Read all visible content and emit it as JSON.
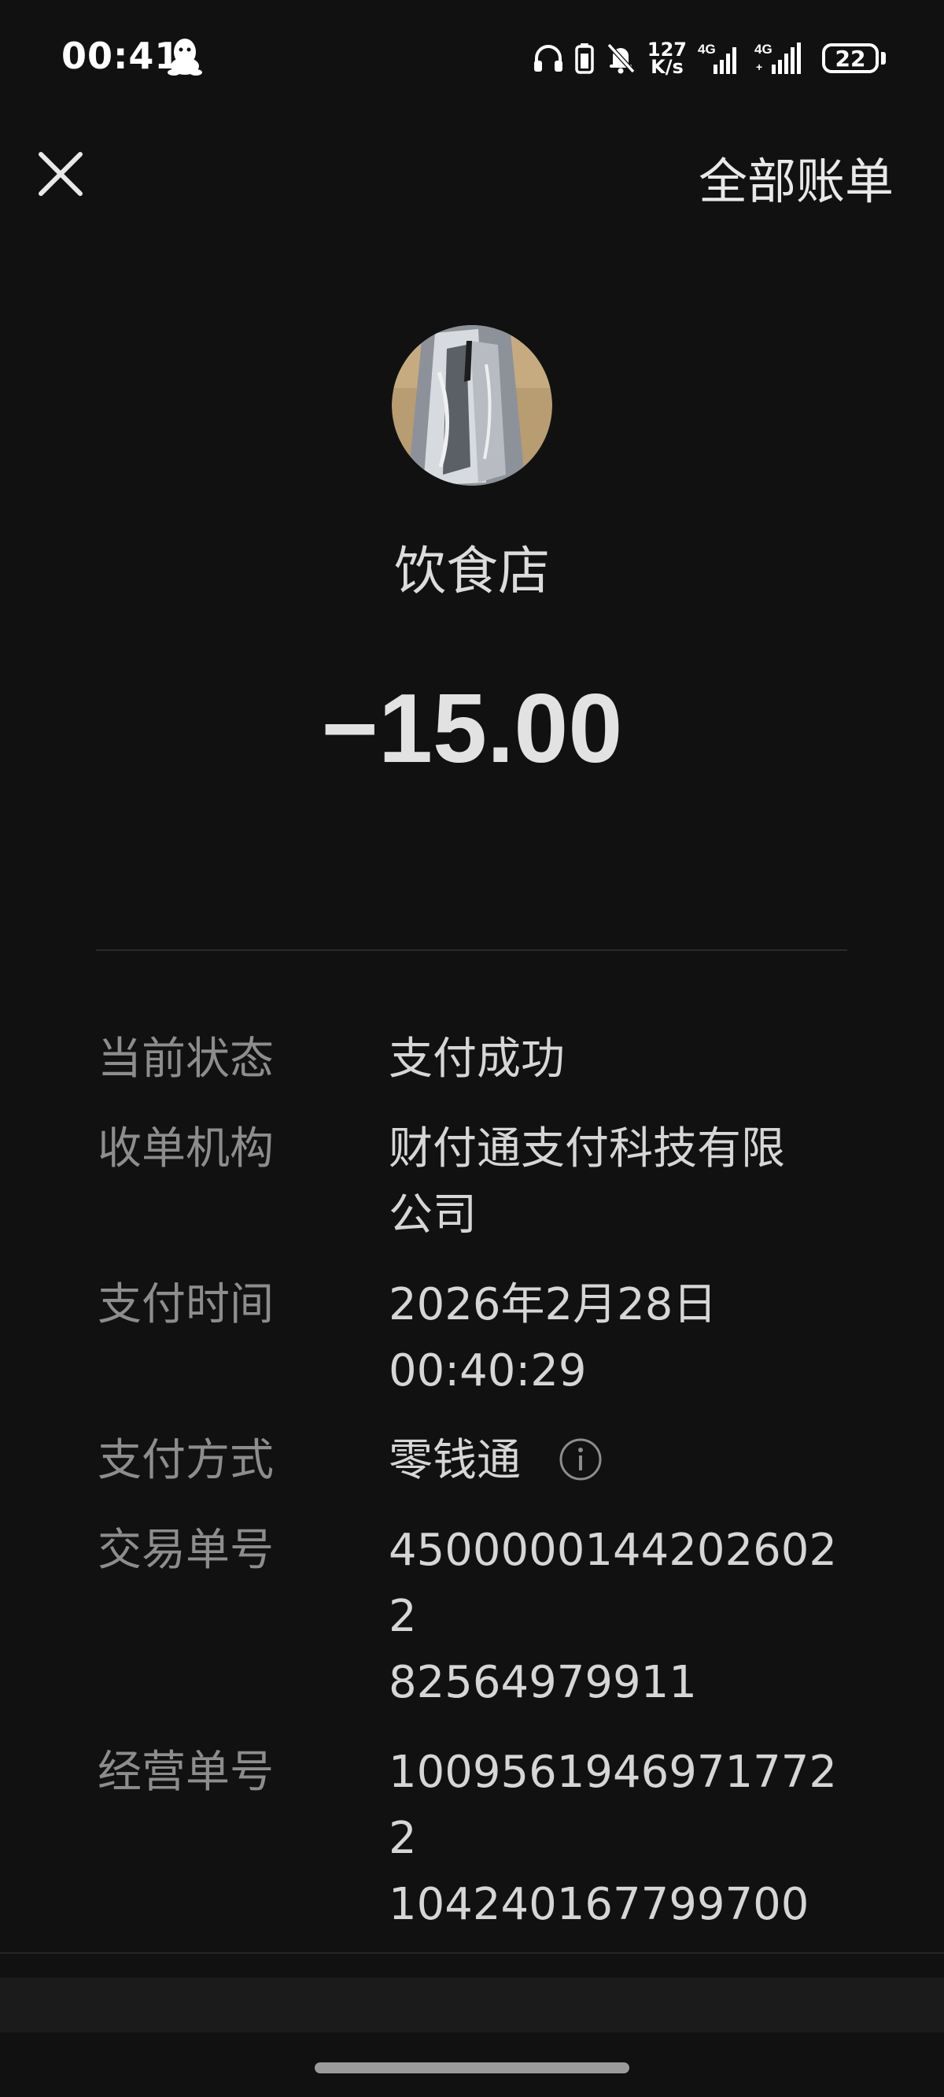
{
  "status_bar": {
    "time": "00:41",
    "net_speed_value": "127",
    "net_speed_unit": "K/s",
    "battery": "22",
    "icons": [
      "qq-icon",
      "headphones-icon",
      "battery-small-icon",
      "mute-bell-icon",
      "signal-4g-icon",
      "signal-4g-plus-icon"
    ]
  },
  "nav": {
    "close_icon": "close-icon",
    "all_bills_label": "全部账单"
  },
  "merchant": {
    "name": "饮食店",
    "amount": "−15.00"
  },
  "details": {
    "status_label": "当前状态",
    "status_value": "支付成功",
    "acquirer_label": "收单机构",
    "acquirer_value_line1": "财付通支付科技有限",
    "acquirer_value_line2": "公司",
    "time_label": "支付时间",
    "time_value_line1": "2026年2月28日",
    "time_value_line2": "00:40:29",
    "method_label": "支付方式",
    "method_value": "零钱通",
    "trade_no_label": "交易单号",
    "trade_no_line1": "45000001442026022",
    "trade_no_line2": "82564979911",
    "merchant_no_label": "经营单号",
    "merchant_no_line1": "10095619469717722",
    "merchant_no_line2": "104240167799700"
  },
  "colors": {
    "background": "#111111",
    "label_gray": "#8d8d8d",
    "value_text": "#d6d6d6"
  }
}
